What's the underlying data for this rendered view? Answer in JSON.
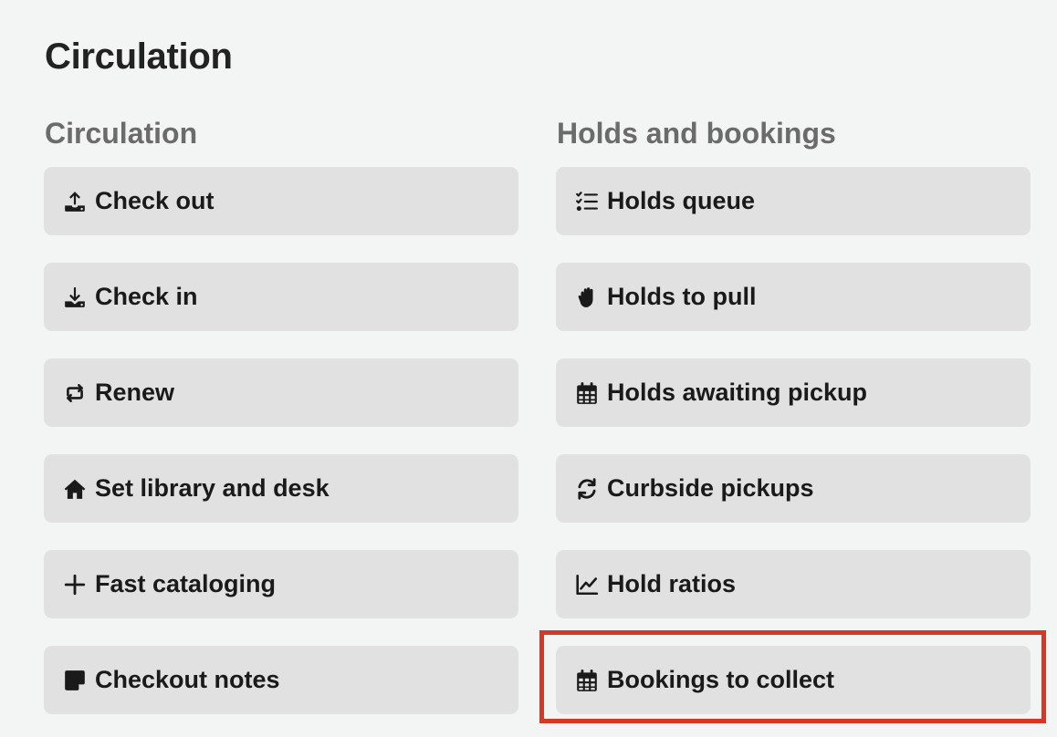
{
  "page": {
    "title": "Circulation"
  },
  "circulation": {
    "heading": "Circulation",
    "items": [
      {
        "label": "Check out",
        "icon": "upload-tray-icon"
      },
      {
        "label": "Check in",
        "icon": "download-tray-icon"
      },
      {
        "label": "Renew",
        "icon": "repeat-icon"
      },
      {
        "label": "Set library and desk",
        "icon": "home-icon"
      },
      {
        "label": "Fast cataloging",
        "icon": "plus-icon"
      },
      {
        "label": "Checkout notes",
        "icon": "sticky-note-icon"
      }
    ]
  },
  "holds": {
    "heading": "Holds and bookings",
    "items": [
      {
        "label": "Holds queue",
        "icon": "checklist-icon"
      },
      {
        "label": "Holds to pull",
        "icon": "hand-icon"
      },
      {
        "label": "Holds awaiting pickup",
        "icon": "calendar-icon"
      },
      {
        "label": "Curbside pickups",
        "icon": "refresh-icon"
      },
      {
        "label": "Hold ratios",
        "icon": "line-chart-icon"
      },
      {
        "label": "Bookings to collect",
        "icon": "calendar-icon"
      }
    ]
  },
  "colors": {
    "highlight": "#d03a28",
    "button_bg": "#e1e1e1",
    "page_bg": "#f3f4f4"
  }
}
